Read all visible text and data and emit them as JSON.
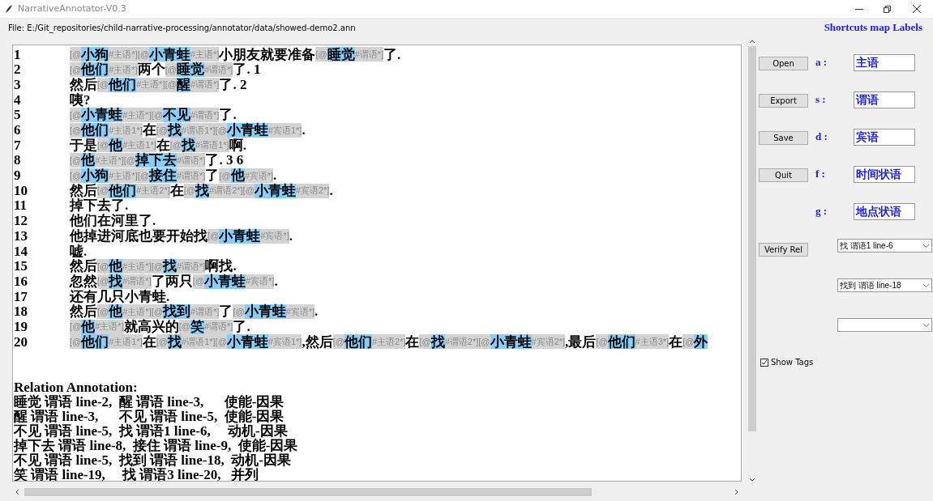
{
  "window": {
    "title": "NarrativeAnnotator-V0.3"
  },
  "file_label": "File: E:/Git_repositories/child-narrative-processing/annotator/data/showed-demo2.ann",
  "editor": {
    "lines": [
      {
        "number": "1",
        "segments": [
          {
            "kind": "marker",
            "text": "[@"
          },
          {
            "kind": "word",
            "text": "小狗"
          },
          {
            "kind": "marker",
            "text": "#主语*][@"
          },
          {
            "kind": "word",
            "text": "小青蛙"
          },
          {
            "kind": "marker",
            "text": "#主语*]"
          },
          {
            "kind": "plain",
            "text": "小朋友就要准备"
          },
          {
            "kind": "marker",
            "text": "[@"
          },
          {
            "kind": "word",
            "text": "睡觉"
          },
          {
            "kind": "marker",
            "text": "#谓语*]"
          },
          {
            "kind": "plain",
            "text": "了."
          }
        ]
      },
      {
        "number": "2",
        "segments": [
          {
            "kind": "marker",
            "text": "[@"
          },
          {
            "kind": "word",
            "text": "他们"
          },
          {
            "kind": "marker",
            "text": "#主语*]"
          },
          {
            "kind": "plain",
            "text": "两个"
          },
          {
            "kind": "marker",
            "text": "[@"
          },
          {
            "kind": "word",
            "text": "睡觉"
          },
          {
            "kind": "marker",
            "text": "#谓语*]"
          },
          {
            "kind": "plain",
            "text": "了. 1"
          }
        ]
      },
      {
        "number": "3",
        "segments": [
          {
            "kind": "plain",
            "text": "然后"
          },
          {
            "kind": "marker",
            "text": "[@"
          },
          {
            "kind": "word",
            "text": "他们"
          },
          {
            "kind": "marker",
            "text": "#主语*][@"
          },
          {
            "kind": "word",
            "text": "醒"
          },
          {
            "kind": "marker",
            "text": "#谓语*]"
          },
          {
            "kind": "plain",
            "text": "了. 2"
          }
        ]
      },
      {
        "number": "4",
        "segments": [
          {
            "kind": "plain",
            "text": "咦?"
          }
        ]
      },
      {
        "number": "5",
        "segments": [
          {
            "kind": "marker",
            "text": "[@"
          },
          {
            "kind": "word",
            "text": "小青蛙"
          },
          {
            "kind": "marker",
            "text": "#主语*][@"
          },
          {
            "kind": "word",
            "text": "不见"
          },
          {
            "kind": "marker",
            "text": "#谓语*]"
          },
          {
            "kind": "plain",
            "text": "了."
          }
        ]
      },
      {
        "number": "6",
        "segments": [
          {
            "kind": "marker",
            "text": "[@"
          },
          {
            "kind": "word",
            "text": "他们"
          },
          {
            "kind": "marker",
            "text": "#主语1*]"
          },
          {
            "kind": "plain",
            "text": "在"
          },
          {
            "kind": "marker",
            "text": "[@"
          },
          {
            "kind": "word",
            "text": "找"
          },
          {
            "kind": "marker",
            "text": "#谓语1*][@"
          },
          {
            "kind": "word",
            "text": "小青蛙"
          },
          {
            "kind": "marker",
            "text": "#宾语1*]"
          },
          {
            "kind": "plain",
            "text": "."
          }
        ]
      },
      {
        "number": "7",
        "segments": [
          {
            "kind": "plain",
            "text": "于是"
          },
          {
            "kind": "marker",
            "text": "[@"
          },
          {
            "kind": "word",
            "text": "他"
          },
          {
            "kind": "marker",
            "text": "#主语1*]"
          },
          {
            "kind": "plain",
            "text": "在"
          },
          {
            "kind": "marker",
            "text": "[@"
          },
          {
            "kind": "word",
            "text": "找"
          },
          {
            "kind": "marker",
            "text": "#谓语1*]"
          },
          {
            "kind": "plain",
            "text": "啊."
          }
        ]
      },
      {
        "number": "8",
        "segments": [
          {
            "kind": "marker",
            "text": "[@"
          },
          {
            "kind": "word",
            "text": "他"
          },
          {
            "kind": "marker",
            "text": "#主语*][@"
          },
          {
            "kind": "word",
            "text": "掉下去"
          },
          {
            "kind": "marker",
            "text": "#谓语*]"
          },
          {
            "kind": "plain",
            "text": "了. 3 6"
          }
        ]
      },
      {
        "number": "9",
        "segments": [
          {
            "kind": "marker",
            "text": "[@"
          },
          {
            "kind": "word",
            "text": "小狗"
          },
          {
            "kind": "marker",
            "text": "#主语*][@"
          },
          {
            "kind": "word",
            "text": "接住"
          },
          {
            "kind": "marker",
            "text": "#谓语*]"
          },
          {
            "kind": "plain",
            "text": "了"
          },
          {
            "kind": "marker",
            "text": "[@"
          },
          {
            "kind": "word",
            "text": "他"
          },
          {
            "kind": "marker",
            "text": "#宾语*]"
          },
          {
            "kind": "plain",
            "text": "."
          }
        ]
      },
      {
        "number": "10",
        "segments": [
          {
            "kind": "plain",
            "text": "然后"
          },
          {
            "kind": "marker",
            "text": "[@"
          },
          {
            "kind": "word",
            "text": "他们"
          },
          {
            "kind": "marker",
            "text": "#主语2*]"
          },
          {
            "kind": "plain",
            "text": "在"
          },
          {
            "kind": "marker",
            "text": "[@"
          },
          {
            "kind": "word",
            "text": "找"
          },
          {
            "kind": "marker",
            "text": "#谓语2*][@"
          },
          {
            "kind": "word",
            "text": "小青蛙"
          },
          {
            "kind": "marker",
            "text": "#宾语2*]"
          },
          {
            "kind": "plain",
            "text": "."
          }
        ]
      },
      {
        "number": "11",
        "segments": [
          {
            "kind": "plain",
            "text": "掉下去了."
          }
        ]
      },
      {
        "number": "12",
        "segments": [
          {
            "kind": "plain",
            "text": "他们在河里了."
          }
        ]
      },
      {
        "number": "13",
        "segments": [
          {
            "kind": "plain",
            "text": "他掉进河底也要开始找"
          },
          {
            "kind": "marker",
            "text": "[@"
          },
          {
            "kind": "word",
            "text": "小青蛙"
          },
          {
            "kind": "marker",
            "text": "#宾语*]"
          },
          {
            "kind": "plain",
            "text": "."
          }
        ]
      },
      {
        "number": "14",
        "segments": [
          {
            "kind": "plain",
            "text": "嘘."
          }
        ]
      },
      {
        "number": "15",
        "segments": [
          {
            "kind": "plain",
            "text": "然后"
          },
          {
            "kind": "marker",
            "text": "[@"
          },
          {
            "kind": "word",
            "text": "他"
          },
          {
            "kind": "marker",
            "text": "#主语*][@"
          },
          {
            "kind": "word",
            "text": "找"
          },
          {
            "kind": "marker",
            "text": "#谓语*]"
          },
          {
            "kind": "plain",
            "text": "啊找."
          }
        ]
      },
      {
        "number": "16",
        "segments": [
          {
            "kind": "plain",
            "text": "忽然"
          },
          {
            "kind": "marker",
            "text": "[@"
          },
          {
            "kind": "word",
            "text": "找"
          },
          {
            "kind": "marker",
            "text": "#谓语*]"
          },
          {
            "kind": "plain",
            "text": "了两只"
          },
          {
            "kind": "marker",
            "text": "[@"
          },
          {
            "kind": "word",
            "text": "小青蛙"
          },
          {
            "kind": "marker",
            "text": "#宾语*]"
          },
          {
            "kind": "plain",
            "text": "."
          }
        ]
      },
      {
        "number": "17",
        "segments": [
          {
            "kind": "plain",
            "text": "还有几只小青蛙."
          }
        ]
      },
      {
        "number": "18",
        "segments": [
          {
            "kind": "plain",
            "text": "然后"
          },
          {
            "kind": "marker",
            "text": "[@"
          },
          {
            "kind": "word",
            "text": "他"
          },
          {
            "kind": "marker",
            "text": "#主语*][@"
          },
          {
            "kind": "word",
            "text": "找到"
          },
          {
            "kind": "marker",
            "text": "#谓语*]"
          },
          {
            "kind": "plain",
            "text": "了"
          },
          {
            "kind": "marker",
            "text": "[@"
          },
          {
            "kind": "word",
            "text": "小青蛙"
          },
          {
            "kind": "marker",
            "text": "#宾语*]"
          },
          {
            "kind": "plain",
            "text": "."
          }
        ]
      },
      {
        "number": "19",
        "segments": [
          {
            "kind": "marker",
            "text": "[@"
          },
          {
            "kind": "word",
            "text": "他"
          },
          {
            "kind": "marker",
            "text": "#主语*]"
          },
          {
            "kind": "plain",
            "text": "就高兴的"
          },
          {
            "kind": "marker",
            "text": "[@"
          },
          {
            "kind": "word",
            "text": "笑"
          },
          {
            "kind": "marker",
            "text": "#谓语*]"
          },
          {
            "kind": "plain",
            "text": "了."
          }
        ]
      },
      {
        "number": "20",
        "segments": [
          {
            "kind": "marker",
            "text": "[@"
          },
          {
            "kind": "word",
            "text": "他们"
          },
          {
            "kind": "marker",
            "text": "#主语1*]"
          },
          {
            "kind": "plain",
            "text": "在"
          },
          {
            "kind": "marker",
            "text": "[@"
          },
          {
            "kind": "word",
            "text": "找"
          },
          {
            "kind": "marker",
            "text": "#谓语1*][@"
          },
          {
            "kind": "word",
            "text": "小青蛙"
          },
          {
            "kind": "marker",
            "text": "#宾语1*]"
          },
          {
            "kind": "plain",
            "text": ",然后"
          },
          {
            "kind": "marker",
            "text": "[@"
          },
          {
            "kind": "word",
            "text": "他们"
          },
          {
            "kind": "marker",
            "text": "#主语2*]"
          },
          {
            "kind": "plain",
            "text": "在"
          },
          {
            "kind": "marker",
            "text": "[@"
          },
          {
            "kind": "word",
            "text": "找"
          },
          {
            "kind": "marker",
            "text": "#谓语2*][@"
          },
          {
            "kind": "word",
            "text": "小青蛙"
          },
          {
            "kind": "marker",
            "text": "#宾语2*]"
          },
          {
            "kind": "plain",
            "text": ",最后"
          },
          {
            "kind": "marker",
            "text": "[@"
          },
          {
            "kind": "word",
            "text": "他们"
          },
          {
            "kind": "marker",
            "text": "#主语3*]"
          },
          {
            "kind": "plain",
            "text": "在"
          },
          {
            "kind": "marker",
            "text": "[@"
          },
          {
            "kind": "word",
            "text": "外"
          }
        ]
      }
    ],
    "relation_heading": "Relation Annotation:",
    "relations": [
      "睡觉 谓语 line-2,  醒 谓语 line-3,      使能-因果",
      "醒 谓语 line-3,      不见 谓语 line-5,  使能-因果",
      "不见 谓语 line-5,  找 谓语1 line-6,     动机-因果",
      "掉下去 谓语 line-8,  接住 谓语 line-9,  使能-因果",
      "不见 谓语 line-5,  找到 谓语 line-18,  动机-因果",
      "笑 谓语 line-19,     找 谓语3 line-20,   并列"
    ]
  },
  "shortcuts_title": "Shortcuts map Labels",
  "rows": [
    {
      "button": "Open",
      "key": "a :",
      "value": "主语"
    },
    {
      "button": "Export",
      "key": "s :",
      "value": "谓语"
    },
    {
      "button": "Save",
      "key": "d :",
      "value": "宾语"
    },
    {
      "button": "Quit",
      "key": "f :",
      "value": "时间状语"
    },
    {
      "key": "g :",
      "value": "地点状语"
    }
  ],
  "verify_button": "Verify Rel",
  "relation_selects": [
    {
      "kind": "filled",
      "value": "找 谓语1 line-6"
    },
    {
      "kind": "filled",
      "value": "找到 谓语 line-18"
    },
    {
      "kind": "empty"
    }
  ],
  "show_tags": {
    "label": "Show Tags",
    "checked": true
  }
}
